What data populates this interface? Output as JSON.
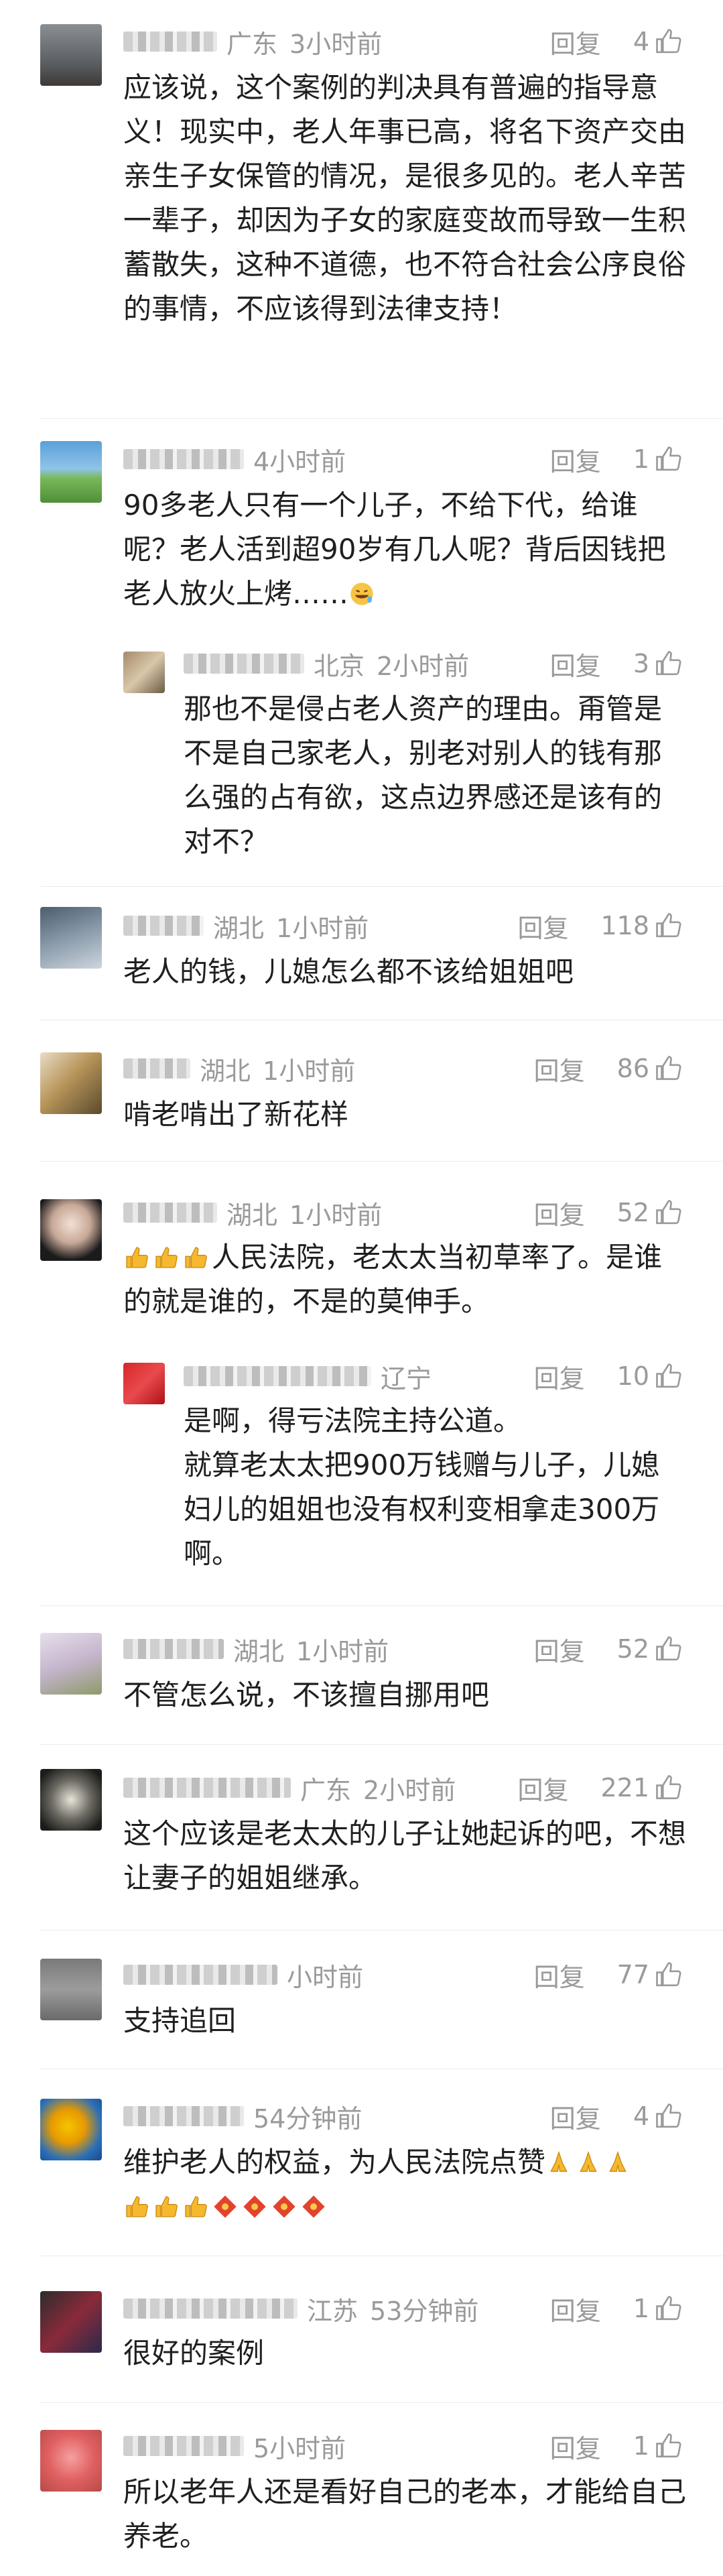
{
  "actions": {
    "reply_label": "回复"
  },
  "comments": [
    {
      "location": "广东",
      "time": "3小时前",
      "likes": "4",
      "text": "应该说，这个案例的判决具有普遍的指导意义！现实中，老人年事已高，将名下资产交由亲生子女保管的情况，是很多见的。老人辛苦一辈子，却因为子女的家庭变故而导致一生积蓄散失，这种不道德，也不符合社会公序良俗的事情，不应该得到法律支持！"
    },
    {
      "location": "",
      "time": "4小时前",
      "likes": "1",
      "text": "90多老人只有一个儿子，不给下代，给谁呢？老人活到超90岁有几人呢？背后因钱把老人放火上烤……"
    },
    {
      "location": "北京",
      "time": "2小时前",
      "likes": "3",
      "text": "那也不是侵占老人资产的理由。甭管是不是自己家老人，别老对别人的钱有那么强的占有欲，这点边界感还是该有的对不？"
    },
    {
      "location": "湖北",
      "time": "1小时前",
      "likes": "118",
      "text": "老人的钱，儿媳怎么都不该给姐姐吧"
    },
    {
      "location": "湖北",
      "time": "1小时前",
      "likes": "86",
      "text": "啃老啃出了新花样"
    },
    {
      "location": "湖北",
      "time": "1小时前",
      "likes": "52",
      "text": "人民法院，老太太当初草率了。是谁的就是谁的，不是的莫伸手。"
    },
    {
      "location": "辽宁",
      "time": "",
      "likes": "10",
      "text": "是啊，得亏法院主持公道。\n就算老太太把900万钱赠与儿子，儿媳妇儿的姐姐也没有权利变相拿走300万啊。"
    },
    {
      "location": "湖北",
      "time": "1小时前",
      "likes": "52",
      "text": "不管怎么说，不该擅自挪用吧"
    },
    {
      "location": "广东",
      "time": "2小时前",
      "likes": "221",
      "text": "这个应该是老太太的儿子让她起诉的吧，不想让妻子的姐姐继承。"
    },
    {
      "location": "",
      "time": "小时前",
      "likes": "77",
      "text": "支持追回"
    },
    {
      "location": "",
      "time": "54分钟前",
      "likes": "4",
      "text": "维护老人的权益，为人民法院点赞"
    },
    {
      "location": "江苏",
      "time": "53分钟前",
      "likes": "1",
      "text": "很好的案例"
    },
    {
      "location": "",
      "time": "5小时前",
      "likes": "1",
      "text": "所以老年人还是看好自己的老本，才能给自己养老。"
    }
  ],
  "colors": {
    "meta": "#9a9a9a",
    "text": "#1f1f1f",
    "divider": "#ececec"
  }
}
